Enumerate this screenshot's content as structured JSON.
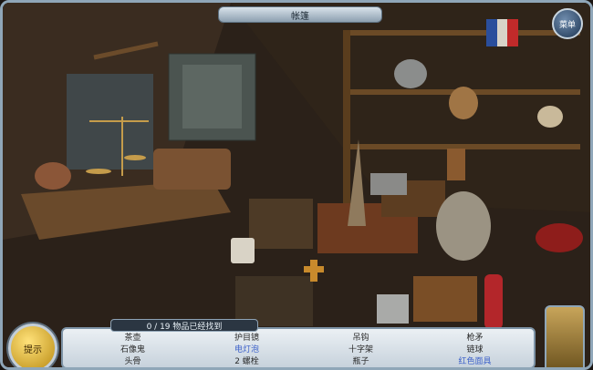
{
  "window": {
    "title": "帐篷"
  },
  "buttons": {
    "menu": "菜单",
    "hint": "提示"
  },
  "counter": "0 / 19 物品已经找到",
  "items": [
    {
      "label": "茶壶",
      "state": "normal"
    },
    {
      "label": "护目镜",
      "state": "normal"
    },
    {
      "label": "吊钩",
      "state": "normal"
    },
    {
      "label": "枪矛",
      "state": "normal"
    },
    {
      "label": "石像鬼",
      "state": "normal"
    },
    {
      "label": "电灯泡",
      "state": "found"
    },
    {
      "label": "十字架",
      "state": "normal"
    },
    {
      "label": "链球",
      "state": "normal"
    },
    {
      "label": "头骨",
      "state": "normal"
    },
    {
      "label": "2 螺栓",
      "state": "normal"
    },
    {
      "label": "瓶子",
      "state": "normal"
    },
    {
      "label": "红色面具",
      "state": "found"
    }
  ],
  "colors": {
    "frame": "#8fa6b8",
    "found_text": "#3d61c9",
    "panel": "#ebf0f4"
  }
}
